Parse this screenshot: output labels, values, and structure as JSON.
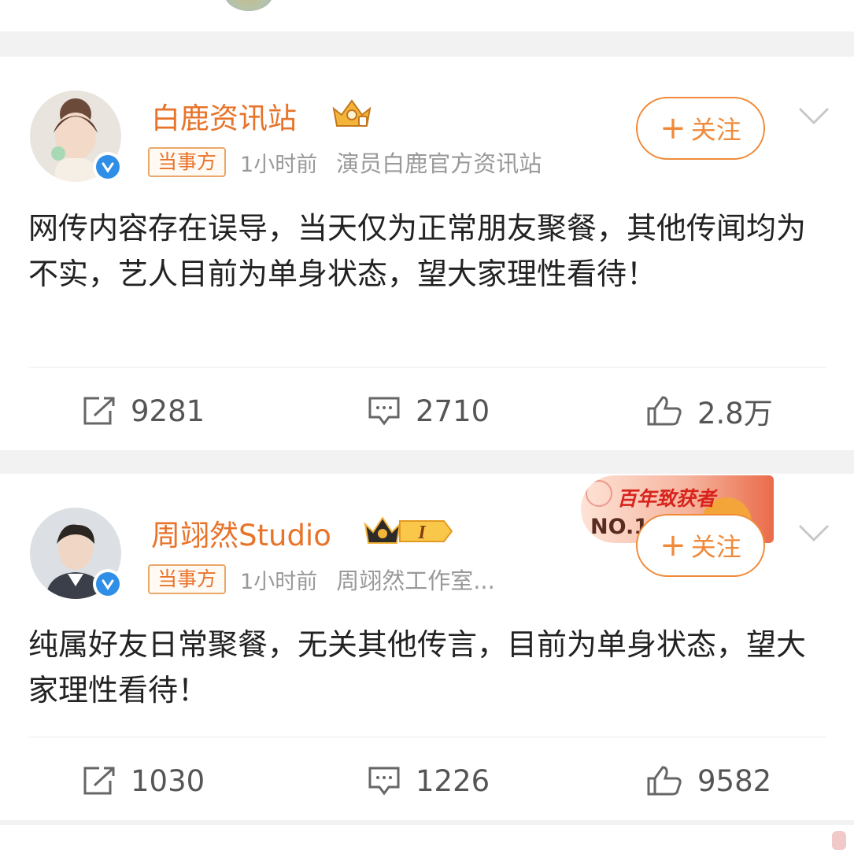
{
  "posts": [
    {
      "username": "白鹿资讯站",
      "tag": "当事方",
      "time": "1小时前",
      "source": "演员白鹿官方资讯站",
      "follow_label": "+关注",
      "follow_text": "关注",
      "content": "网传内容存在误导，当天仅为正常朋友聚餐，其他传闻均为不实，艺人目前为单身状态，望大家理性看待！",
      "reposts": "9281",
      "comments": "2710",
      "likes": "2.8万"
    },
    {
      "username": "周翊然Studio",
      "tag": "当事方",
      "time": "1小时前",
      "source": "周翊然工作室...",
      "follow_label": "+关注",
      "follow_text": "关注",
      "content": "纯属好友日常聚餐，无关其他传言，目前为单身状态，望大家理性看待！",
      "reposts": "1030",
      "comments": "1226",
      "likes": "9582",
      "member_level": "I"
    }
  ],
  "promo": {
    "line1": "百年致获者",
    "line2": "NO.1"
  },
  "colors": {
    "accent": "#e8732a",
    "verified": "#2f8ee6",
    "separator": "#f2f2f2"
  },
  "icons": [
    "repost-icon",
    "comment-icon",
    "like-icon",
    "verified-icon",
    "chevron-down-icon",
    "crown-icon"
  ]
}
